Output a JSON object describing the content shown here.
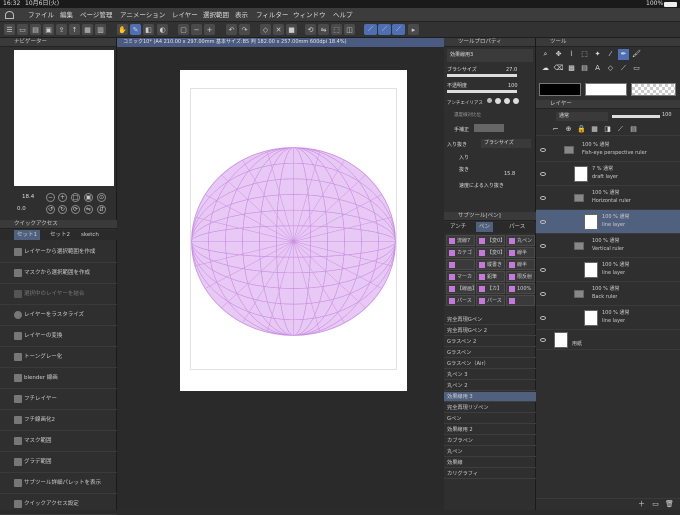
{
  "status": {
    "time": "16:32",
    "date": "10月6日(火)",
    "battery": "100%"
  },
  "menu": [
    "ファイル",
    "編集",
    "ページ管理",
    "アニメーション",
    "レイヤー",
    "選択範囲",
    "表示",
    "フィルター",
    "ウィンドウ",
    "ヘルプ"
  ],
  "navigator": {
    "title": "ナビゲーター",
    "zoom": "18.4",
    "rotation": "0.0"
  },
  "canvas_tab": {
    "label": "コミック10* (A4 210.00 x 297.00mm 基本サイズ:B5 判 182.00 x 257.00mm 600dpi 18.4%)"
  },
  "quick_access": {
    "title": "クイックアクセス",
    "tabs": [
      "セット1",
      "セット2",
      "sketch"
    ],
    "items": [
      "レイヤーから選択範囲を作成",
      "マスクから選択範囲を作成",
      "選択中のレイヤーを結合",
      "レイヤーをラスタライズ",
      "レイヤーの変換",
      "トーングレー化",
      "blender 線画",
      "フチレイヤー",
      "フチ線画化2",
      "マスク範囲",
      "グラデ範囲",
      "サブツール詳細パレットを表示",
      "クイックアクセス設定"
    ]
  },
  "tool_property": {
    "title": "ツールプロパティ",
    "tool_name": "効果線用3",
    "brush_size_label": "ブラシサイズ",
    "brush_size": "27.0",
    "opacity_label": "不透明度",
    "opacity": "100",
    "antialias_label": "アンチエイリアス",
    "option1": "濃度線対比位",
    "correction_label": "手補正",
    "in_out_label": "入り抜き",
    "in_out_mode": "ブラシサイズ",
    "in": "入り",
    "out": "抜き",
    "out_value": "15.8",
    "speed_label": "速度による入り抜き"
  },
  "subtool": {
    "title": "サブツール[ペン]",
    "tabs": [
      "アンチ",
      "ペン",
      "パース"
    ],
    "grid": [
      [
        "流線7",
        "【変0】",
        "丸ペン"
      ],
      [
        "カテゴ",
        "【変0】",
        "線半"
      ],
      [
        "",
        "縦書き",
        "線半"
      ],
      [
        "マーカ",
        "鉛筆",
        "限反射"
      ],
      [
        "【線画】",
        "【カ】",
        "100%"
      ],
      [
        "パース",
        "パース",
        ""
      ]
    ],
    "list": [
      "完全再現Gペン",
      "完全再現Gペン 2",
      "Gラスペン 2",
      "Gラスペン",
      "Gラスペン（Air）",
      "丸ペン 3",
      "丸ペン 2",
      "効果線用 3",
      "完全再現リゾペン",
      "Gペン",
      "効果線用 2",
      "カブラペン",
      "丸ペン",
      "効果線",
      "カリグラフィ"
    ],
    "selected_index": 7
  },
  "tool": {
    "title": "ツール",
    "icons": [
      "zoom-icon",
      "move-icon",
      "lasso-icon",
      "select-icon",
      "wand-icon",
      "eyedropper-icon",
      "pen-icon",
      "brush-icon",
      "airbrush-icon",
      "eraser-icon",
      "fill-icon",
      "gradient-icon",
      "text-icon",
      "figure-icon",
      "ruler-icon",
      "frame-icon"
    ]
  },
  "colors": {
    "main": "#000000",
    "sub": "#ffffff",
    "accent": "#4f6fb3",
    "ruler": "#d9a6f0"
  },
  "layer_panel": {
    "title": "レイヤー",
    "blend": "通常",
    "opacity": "100",
    "layers": [
      {
        "line1": "100 % 通常",
        "line2": "Fish-eye perspective ruler",
        "indent": 1,
        "type": "folder"
      },
      {
        "line1": "7 % 通常",
        "line2": "draft layer",
        "indent": 2,
        "type": "layer"
      },
      {
        "line1": "100 % 通常",
        "line2": "Horizontal ruler",
        "indent": 2,
        "type": "folder"
      },
      {
        "line1": "100 % 通常",
        "line2": "line layer",
        "indent": 3,
        "type": "layer",
        "selected": true
      },
      {
        "line1": "100 % 通常",
        "line2": "Vertical ruler",
        "indent": 2,
        "type": "folder"
      },
      {
        "line1": "100 % 通常",
        "line2": "line layer",
        "indent": 3,
        "type": "layer"
      },
      {
        "line1": "100 % 通常",
        "line2": "Back ruler",
        "indent": 2,
        "type": "folder"
      },
      {
        "line1": "100 % 通常",
        "line2": "line layer",
        "indent": 3,
        "type": "layer"
      },
      {
        "line1": "",
        "line2": "用紙",
        "indent": 0,
        "type": "paper"
      }
    ]
  }
}
